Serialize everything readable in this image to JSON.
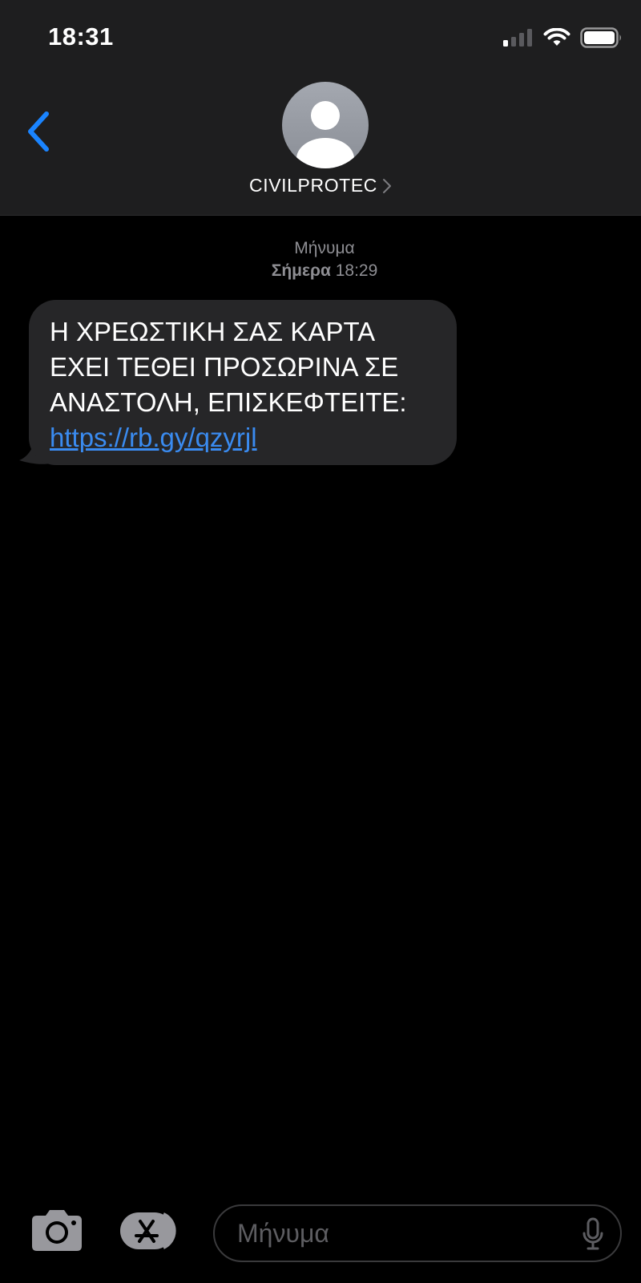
{
  "status_bar": {
    "time": "18:31",
    "icons": [
      "cellular-signal-icon",
      "wifi-icon",
      "battery-icon"
    ]
  },
  "header": {
    "contact_name": "CIVILPROTEC",
    "icons": [
      "back-chevron-icon",
      "avatar-person-icon",
      "chevron-right-icon"
    ]
  },
  "conversation": {
    "meta_label": "Μήνυμα",
    "meta_day": "Σήμερα",
    "meta_time": "18:29",
    "message": {
      "text": "Η ΧΡΕΩΣΤΙΚΗ ΣΑΣ ΚΑΡΤΑ ΕΧΕΙ ΤΕΘΕΙ ΠΡΟΣΩΡΙΝΑ ΣΕ ΑΝΑΣΤΟΛΗ, ΕΠΙΣΚΕΦΤΕΙΤΕ:",
      "link": "https://rb.gy/qzyrjl"
    }
  },
  "composer": {
    "placeholder": "Μήνυμα",
    "icons": [
      "camera-icon",
      "app-store-icon",
      "microphone-icon"
    ]
  },
  "colors": {
    "header_bg": "#1e1e1f",
    "bubble_bg": "#262628",
    "link": "#3a8bf0",
    "accent_blue": "#1a84ff",
    "meta_gray": "#8e8e93"
  }
}
